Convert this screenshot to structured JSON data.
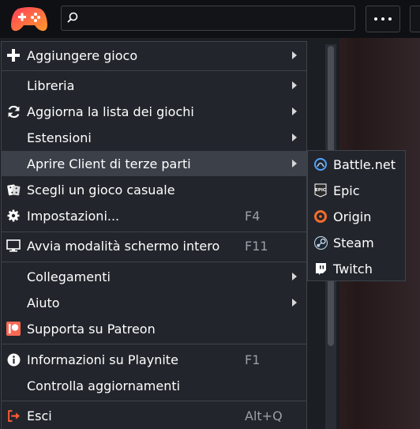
{
  "search": {
    "placeholder": ""
  },
  "menu": {
    "items": [
      {
        "label": "Aggiungere gioco",
        "icon": "plus-icon",
        "submenu": true
      },
      {
        "label": "Libreria",
        "icon": "",
        "submenu": true
      },
      {
        "label": "Aggiorna la lista dei giochi",
        "icon": "refresh-icon",
        "submenu": true
      },
      {
        "label": "Estensioni",
        "icon": "",
        "submenu": true
      },
      {
        "label": "Aprire Client di terze parti",
        "icon": "",
        "submenu": true,
        "highlighted": true
      },
      {
        "label": "Scegli un gioco casuale",
        "icon": "dice-icon",
        "submenu": false
      },
      {
        "label": "Impostazioni...",
        "icon": "gear-icon",
        "shortcut": "F4"
      },
      {
        "label": "Avvia modalità schermo intero",
        "icon": "monitor-icon",
        "shortcut": "F11"
      },
      {
        "label": "Collegamenti",
        "icon": "",
        "submenu": true
      },
      {
        "label": "Aiuto",
        "icon": "",
        "submenu": true
      },
      {
        "label": "Supporta su Patreon",
        "icon": "patreon-icon",
        "submenu": false
      },
      {
        "label": "Informazioni su Playnite",
        "icon": "info-icon",
        "shortcut": "F1"
      },
      {
        "label": "Controlla aggiornamenti",
        "icon": "",
        "submenu": false
      },
      {
        "label": "Esci",
        "icon": "exit-icon",
        "shortcut": "Alt+Q"
      }
    ]
  },
  "submenu": {
    "items": [
      {
        "label": "Battle.net",
        "icon": "battlenet-icon"
      },
      {
        "label": "Epic",
        "icon": "epic-icon"
      },
      {
        "label": "Origin",
        "icon": "origin-icon"
      },
      {
        "label": "Steam",
        "icon": "steam-icon"
      },
      {
        "label": "Twitch",
        "icon": "twitch-icon"
      }
    ]
  },
  "colors": {
    "menu_bg": "#22262c",
    "highlight": "#3b4049",
    "accent_logo": "#ff5a3c",
    "exit_icon": "#ff5a36",
    "patreon": "#f96854",
    "origin": "#f56c2d"
  }
}
